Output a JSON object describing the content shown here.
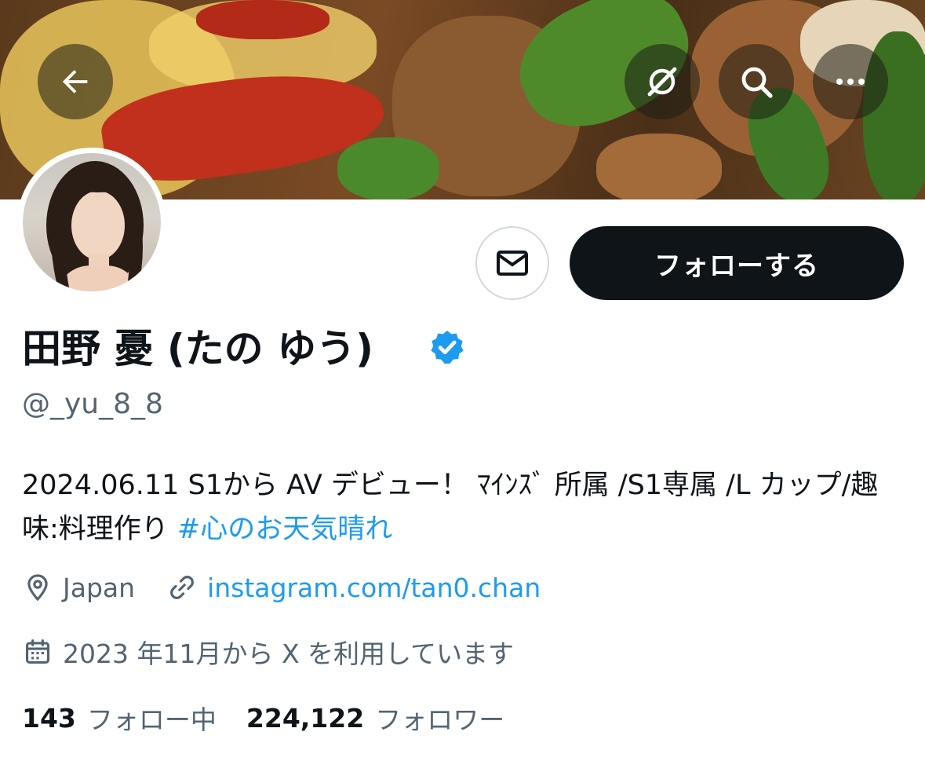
{
  "header": {
    "back_icon": "arrow-left-icon",
    "grok_icon": "slashed-circle-icon",
    "search_icon": "search-icon",
    "more_icon": "more-horizontal-icon"
  },
  "profile": {
    "display_name": "田野 憂 (たの ゆう)",
    "verified": true,
    "handle": "@_yu_8_8",
    "bio_text": "2024.06.11 S1から AV デビュー！ ﾏｲﾝｽﾞ 所属 /S1専属 /L カップ/趣味:料理作り ",
    "bio_hashtag": "#心のお天気晴れ",
    "location": "Japan",
    "website": "instagram.com/tan0.chan",
    "joined": "2023 年11月から X を利用しています"
  },
  "actions": {
    "message_icon": "envelope-icon",
    "follow_label": "フォローする"
  },
  "stats": {
    "following_count": "143",
    "following_label": "フォロー中",
    "followers_count": "224,122",
    "followers_label": "フォロワー"
  },
  "colors": {
    "accent": "#1d9bf0",
    "text": "#0f1419",
    "secondary": "#536471",
    "follow_bg": "#0f1419"
  }
}
